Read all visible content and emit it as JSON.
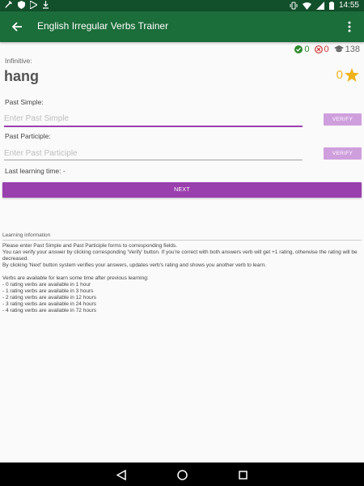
{
  "status_bar": {
    "time": "14:55",
    "left_icons": [
      "wrench-icon",
      "shield-icon",
      "play-store-icon",
      "download-icon"
    ],
    "right_icons": [
      "vibrate-icon",
      "wifi-icon",
      "signal-icon",
      "battery-icon"
    ]
  },
  "app_bar": {
    "title": "English Irregular Verbs Trainer",
    "back_icon": "arrow-back-icon",
    "menu_icon": "more-vert-icon"
  },
  "stats": {
    "correct": "0",
    "wrong": "0",
    "total": "138"
  },
  "verb": {
    "label": "Infinitive:",
    "word": "hang",
    "rating": "0"
  },
  "past_simple": {
    "label": "Past Simple:",
    "value": "",
    "placeholder": "Enter Past Simple",
    "verify_label": "VERIFY"
  },
  "past_participle": {
    "label": "Past Participle:",
    "value": "",
    "placeholder": "Enter Past Participle",
    "verify_label": "VERIFY"
  },
  "last_learning": "Last learning time: -",
  "next_label": "NEXT",
  "info": {
    "header": "Learning information",
    "lines": [
      "Please enter Past Simple and Past Participle forms to corresponding fields.",
      "You can verify your answer by clicking corresponding 'Verify' button. If you're correct with both answers verb will get +1 rating, otherwise the rating will be decreased.",
      "By clicking 'Next' button system verifies your answers, updates verb's rating and shows you another verb to learn.",
      "Verbs are available for learn some time after previous learning:",
      "- 0 rating verbs are available in 1 hour",
      "- 1 rating verbs are available in 3 hours",
      "- 2 rating verbs are available in 12 hours",
      "- 3 rating verbs are available in 24 hours",
      "- 4 rating verbs are available in 72 hours"
    ]
  },
  "colors": {
    "app_bar": "#1b6d3a",
    "status_bar": "#124f2b",
    "accent": "#9a3fae",
    "verify_button": "#cf9fdd",
    "star": "#f0b21a"
  }
}
